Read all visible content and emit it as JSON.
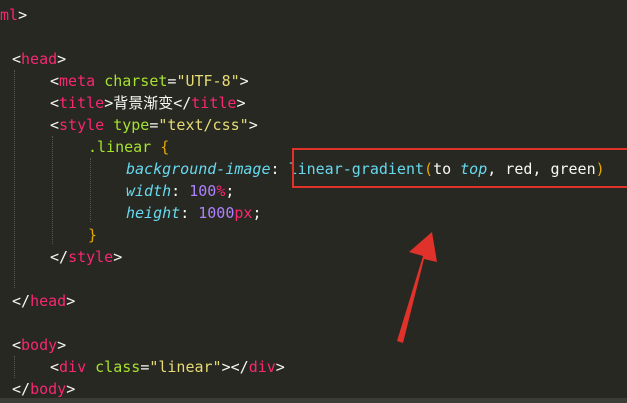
{
  "lines": [
    {
      "segments": [
        {
          "text": "ml",
          "cls": "tag"
        },
        {
          "text": ">",
          "cls": "punct"
        }
      ]
    },
    {
      "segments": []
    },
    {
      "segments": [
        {
          "text": "<",
          "cls": "punct"
        },
        {
          "text": "head",
          "cls": "tag"
        },
        {
          "text": ">",
          "cls": "punct"
        }
      ]
    },
    {
      "segments": [
        {
          "text": "<",
          "cls": "punct"
        },
        {
          "text": "meta",
          "cls": "tag"
        },
        {
          "text": " ",
          "cls": "punct"
        },
        {
          "text": "charset",
          "cls": "attr"
        },
        {
          "text": "=",
          "cls": "punct"
        },
        {
          "text": "\"UTF-8\"",
          "cls": "str"
        },
        {
          "text": ">",
          "cls": "punct"
        }
      ]
    },
    {
      "segments": [
        {
          "text": "<",
          "cls": "punct"
        },
        {
          "text": "title",
          "cls": "tag"
        },
        {
          "text": ">背景渐变</",
          "cls": "punct"
        },
        {
          "text": "title",
          "cls": "tag"
        },
        {
          "text": ">",
          "cls": "punct"
        }
      ]
    },
    {
      "segments": [
        {
          "text": "<",
          "cls": "punct"
        },
        {
          "text": "style",
          "cls": "tag"
        },
        {
          "text": " ",
          "cls": "punct"
        },
        {
          "text": "type",
          "cls": "attr"
        },
        {
          "text": "=",
          "cls": "punct"
        },
        {
          "text": "\"text/css\"",
          "cls": "str"
        },
        {
          "text": ">",
          "cls": "punct"
        }
      ]
    },
    {
      "segments": [
        {
          "text": ".linear",
          "cls": "sel"
        },
        {
          "text": " ",
          "cls": "punct"
        },
        {
          "text": "{",
          "cls": "brace"
        }
      ]
    },
    {
      "segments": [
        {
          "text": "background-image",
          "cls": "prop"
        },
        {
          "text": ": ",
          "cls": "punct"
        },
        {
          "text": "linear-gradient",
          "cls": "fn"
        },
        {
          "text": "(",
          "cls": "brace"
        },
        {
          "text": "to ",
          "cls": "punct"
        },
        {
          "text": "top",
          "cls": "kw"
        },
        {
          "text": ", red, green",
          "cls": "punct"
        },
        {
          "text": ")",
          "cls": "brace"
        }
      ]
    },
    {
      "segments": [
        {
          "text": "width",
          "cls": "prop"
        },
        {
          "text": ": ",
          "cls": "punct"
        },
        {
          "text": "100",
          "cls": "num"
        },
        {
          "text": "%",
          "cls": "unit"
        },
        {
          "text": ";",
          "cls": "punct"
        }
      ]
    },
    {
      "segments": [
        {
          "text": "height",
          "cls": "prop"
        },
        {
          "text": ": ",
          "cls": "punct"
        },
        {
          "text": "1000",
          "cls": "num"
        },
        {
          "text": "px",
          "cls": "unit"
        },
        {
          "text": ";",
          "cls": "punct"
        }
      ]
    },
    {
      "segments": [
        {
          "text": "}",
          "cls": "brace"
        }
      ]
    },
    {
      "segments": [
        {
          "text": "</",
          "cls": "punct"
        },
        {
          "text": "style",
          "cls": "tag"
        },
        {
          "text": ">",
          "cls": "punct"
        }
      ]
    },
    {
      "segments": []
    },
    {
      "segments": [
        {
          "text": "</",
          "cls": "punct"
        },
        {
          "text": "head",
          "cls": "tag"
        },
        {
          "text": ">",
          "cls": "punct"
        }
      ]
    },
    {
      "segments": []
    },
    {
      "segments": [
        {
          "text": "<",
          "cls": "punct"
        },
        {
          "text": "body",
          "cls": "tag"
        },
        {
          "text": ">",
          "cls": "punct"
        }
      ]
    },
    {
      "segments": [
        {
          "text": "<",
          "cls": "punct"
        },
        {
          "text": "div",
          "cls": "tag"
        },
        {
          "text": " ",
          "cls": "punct"
        },
        {
          "text": "class",
          "cls": "attr"
        },
        {
          "text": "=",
          "cls": "punct"
        },
        {
          "text": "\"linear\"",
          "cls": "str"
        },
        {
          "text": "></",
          "cls": "punct"
        },
        {
          "text": "div",
          "cls": "tag"
        },
        {
          "text": ">",
          "cls": "punct"
        }
      ]
    },
    {
      "segments": [
        {
          "text": "</",
          "cls": "punct"
        },
        {
          "text": "body",
          "cls": "tag"
        },
        {
          "text": ">",
          "cls": "punct"
        }
      ]
    }
  ],
  "colors": {
    "background": "#272822",
    "annotation": "#e0322a"
  }
}
